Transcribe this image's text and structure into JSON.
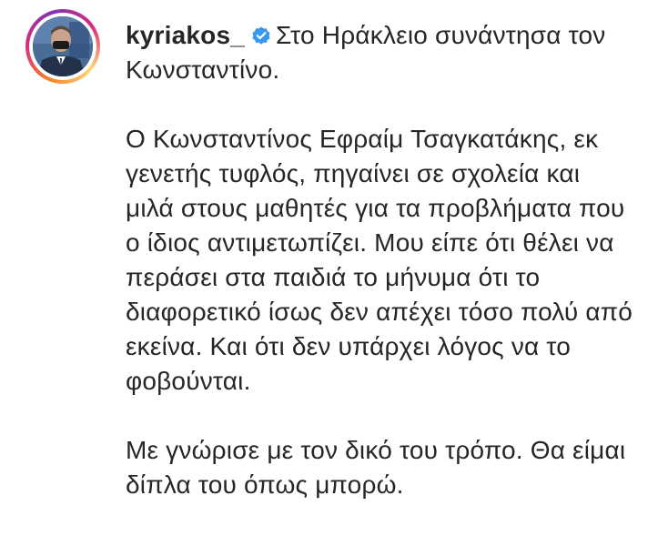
{
  "post": {
    "username": "kyriakos_",
    "verified_icon": "verified-badge-icon",
    "verified_color": "#3897f0",
    "story_ring_colors": [
      "#f58529",
      "#dd2a7b",
      "#8134af",
      "#feda77"
    ],
    "caption": {
      "intro": "Στο Ηράκλειο συνάντησα τον Κωνσταντίνο.",
      "paragraph_2": "Ο Κωνσταντίνος Εφραίμ Τσαγκατάκης, εκ γενετής τυφλός, πηγαίνει σε σχολεία και μιλά στους μαθητές για τα προβλήματα που ο ίδιος αντιμετωπίζει. Μου είπε ότι θέλει να περάσει στα παιδιά το μήνυμα ότι το διαφορετικό ίσως δεν απέχει τόσο πολύ από εκείνα. Και ότι δεν υπάρχει λόγος να το φοβούνται.",
      "paragraph_3": "Με γνώρισε με τον δικό του τρόπο. Θα είμαι δίπλα του όπως μπορώ."
    }
  }
}
